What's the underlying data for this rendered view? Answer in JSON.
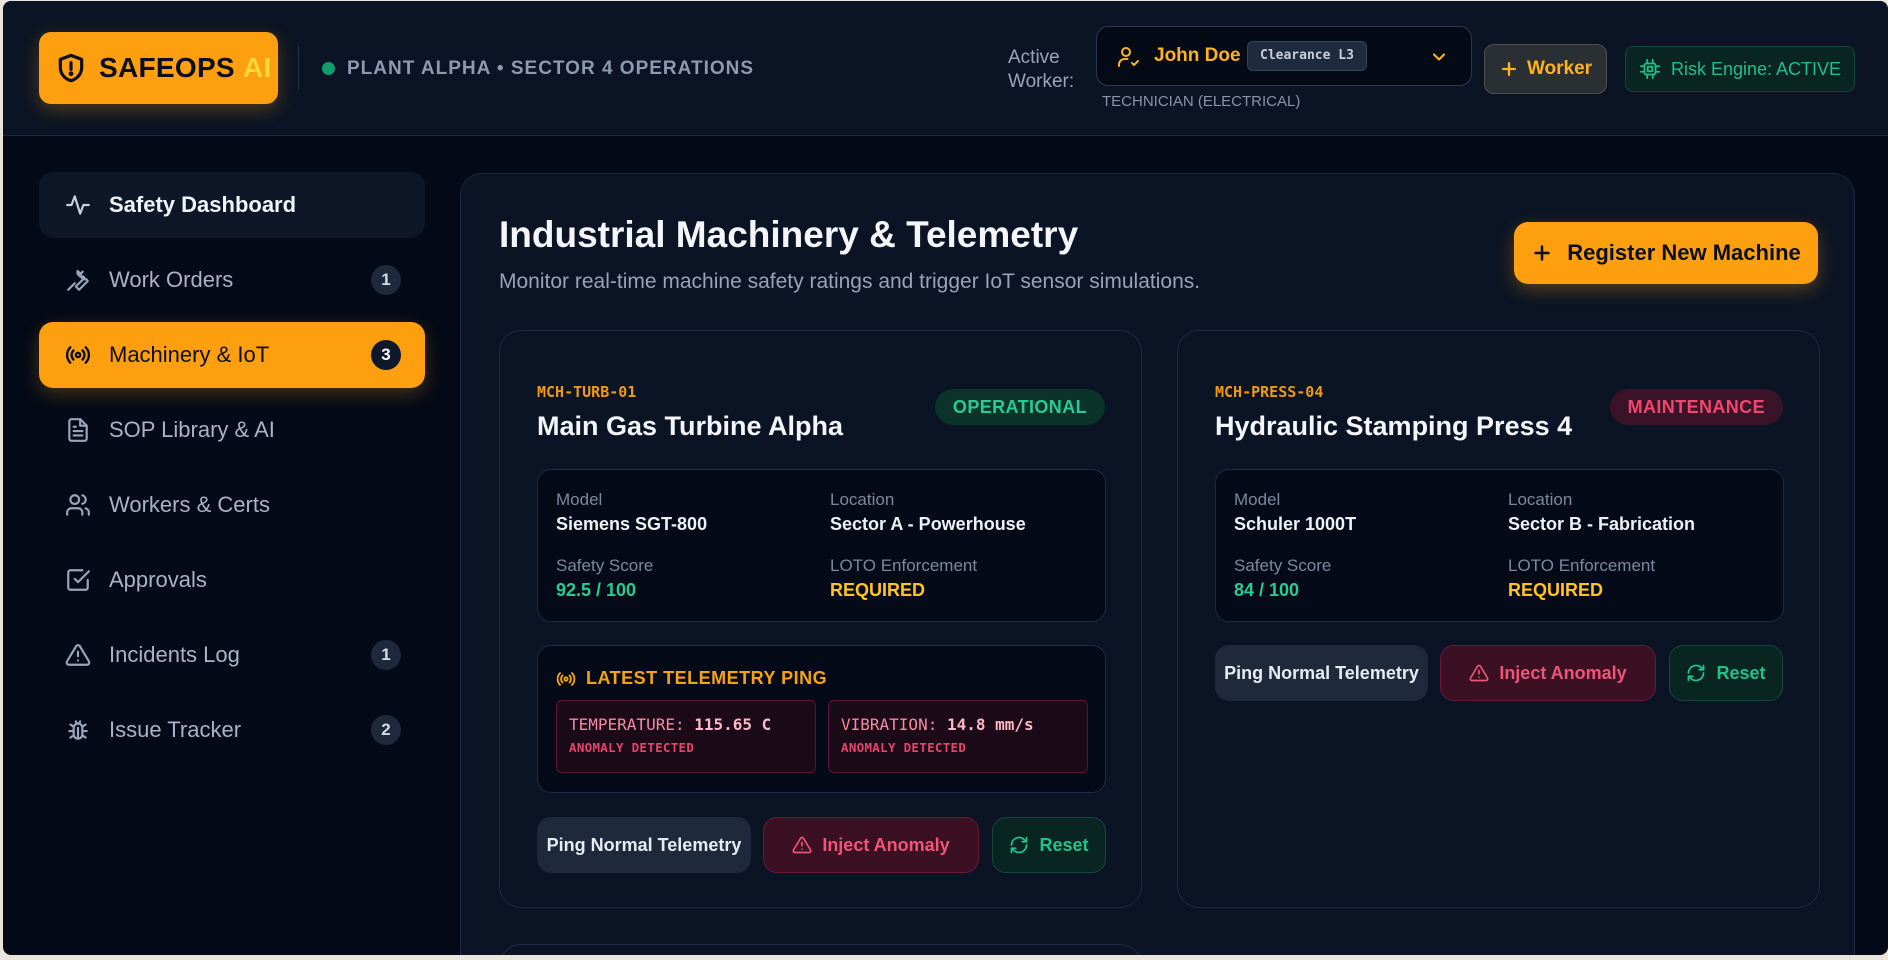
{
  "header": {
    "logo_text": "SAFEOPS",
    "logo_ai": "AI",
    "plant": "PLANT ALPHA • SECTOR 4 OPERATIONS",
    "active_worker_label": "Active Worker:",
    "worker_name": "John Doe",
    "clearance": "Clearance L3",
    "worker_role": "TECHNICIAN (ELECTRICAL)",
    "add_worker_label": "Worker",
    "risk_engine_label": "Risk Engine: ACTIVE"
  },
  "sidebar": {
    "items": [
      {
        "label": "Safety Dashboard",
        "icon": "activity-icon",
        "badge": ""
      },
      {
        "label": "Work Orders",
        "icon": "wrench-icon",
        "badge": "1"
      },
      {
        "label": "Machinery & IoT",
        "icon": "broadcast-icon",
        "badge": "3"
      },
      {
        "label": "SOP Library & AI",
        "icon": "document-icon",
        "badge": ""
      },
      {
        "label": "Workers & Certs",
        "icon": "users-icon",
        "badge": ""
      },
      {
        "label": "Approvals",
        "icon": "checkbox-icon",
        "badge": ""
      },
      {
        "label": "Incidents Log",
        "icon": "warning-icon",
        "badge": "1"
      },
      {
        "label": "Issue Tracker",
        "icon": "bug-icon",
        "badge": "2"
      }
    ]
  },
  "main": {
    "title": "Industrial Machinery & Telemetry",
    "subtitle": "Monitor real-time machine safety ratings and trigger IoT sensor simulations.",
    "register_label": "Register New Machine",
    "labels": {
      "model": "Model",
      "location": "Location",
      "safety_score": "Safety Score",
      "loto": "LOTO Enforcement",
      "ping": "Ping Normal Telemetry",
      "inject": "Inject Anomaly",
      "reset": "Reset",
      "telemetry_head": "LATEST TELEMETRY PING"
    },
    "machines": [
      {
        "id": "MCH-TURB-01",
        "name": "Main Gas Turbine Alpha",
        "status": "OPERATIONAL",
        "model": "Siemens SGT-800",
        "location": "Sector A - Powerhouse",
        "safety_score": "92.5 / 100",
        "loto": "REQUIRED",
        "telemetry": {
          "temp_key": "TEMPERATURE:",
          "temp_val": "115.65 C",
          "temp_alert": "ANOMALY DETECTED",
          "vib_key": "VIBRATION:",
          "vib_val": "14.8 mm/s",
          "vib_alert": "ANOMALY DETECTED"
        }
      },
      {
        "id": "MCH-PRESS-04",
        "name": "Hydraulic Stamping Press 4",
        "status": "MAINTENANCE",
        "model": "Schuler 1000T",
        "location": "Sector B - Fabrication",
        "safety_score": "84 / 100",
        "loto": "REQUIRED"
      }
    ]
  },
  "colors": {
    "accent": "#fe9f0f",
    "background": "#040a17",
    "panel": "#0b1424",
    "success": "#27cc92",
    "danger": "#f1476d",
    "warning": "#ffc41f"
  }
}
